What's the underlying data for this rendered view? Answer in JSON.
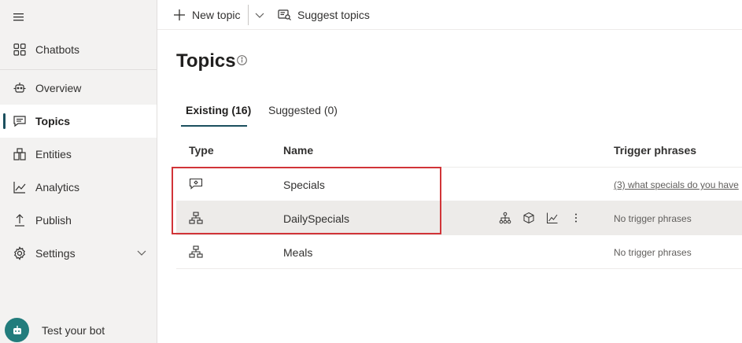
{
  "sidebar": {
    "items": [
      {
        "label": "Chatbots",
        "icon": "grid-icon"
      },
      {
        "label": "Overview",
        "icon": "bot-outline-icon"
      },
      {
        "label": "Topics",
        "icon": "chat-icon",
        "selected": true
      },
      {
        "label": "Entities",
        "icon": "entities-icon"
      },
      {
        "label": "Analytics",
        "icon": "analytics-icon"
      },
      {
        "label": "Publish",
        "icon": "upload-icon"
      },
      {
        "label": "Settings",
        "icon": "gear-icon",
        "expandable": true
      }
    ],
    "test_bot_label": "Test your bot"
  },
  "toolbar": {
    "new_topic_label": "New topic",
    "suggest_topics_label": "Suggest topics"
  },
  "main": {
    "title": "Topics",
    "tabs": [
      {
        "label": "Existing (16)",
        "selected": true
      },
      {
        "label": "Suggested (0)",
        "selected": false
      }
    ],
    "table": {
      "columns": [
        "Type",
        "Name",
        "Trigger phrases"
      ],
      "rows": [
        {
          "type_icon": "chat-bubble-icon",
          "name": "Specials",
          "trigger": "(3) what specials do you have",
          "trigger_is_link": true
        },
        {
          "type_icon": "hierarchy-icon",
          "name": "DailySpecials",
          "trigger": "No trigger phrases",
          "trigger_is_link": false,
          "hovered": true
        },
        {
          "type_icon": "hierarchy-icon",
          "name": "Meals",
          "trigger": "No trigger phrases",
          "trigger_is_link": false
        }
      ]
    }
  },
  "colors": {
    "accent": "#1b4f5e",
    "highlight": "#d13438",
    "bot_avatar": "#227c7c"
  }
}
